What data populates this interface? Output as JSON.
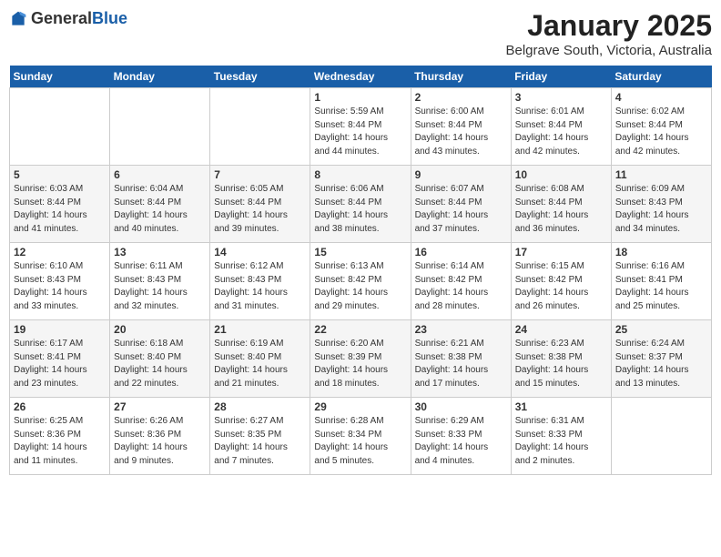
{
  "header": {
    "logo_general": "General",
    "logo_blue": "Blue",
    "month": "January 2025",
    "location": "Belgrave South, Victoria, Australia"
  },
  "days_of_week": [
    "Sunday",
    "Monday",
    "Tuesday",
    "Wednesday",
    "Thursday",
    "Friday",
    "Saturday"
  ],
  "weeks": [
    {
      "cells": [
        {
          "date": "",
          "info": ""
        },
        {
          "date": "",
          "info": ""
        },
        {
          "date": "",
          "info": ""
        },
        {
          "date": "1",
          "info": "Sunrise: 5:59 AM\nSunset: 8:44 PM\nDaylight: 14 hours\nand 44 minutes."
        },
        {
          "date": "2",
          "info": "Sunrise: 6:00 AM\nSunset: 8:44 PM\nDaylight: 14 hours\nand 43 minutes."
        },
        {
          "date": "3",
          "info": "Sunrise: 6:01 AM\nSunset: 8:44 PM\nDaylight: 14 hours\nand 42 minutes."
        },
        {
          "date": "4",
          "info": "Sunrise: 6:02 AM\nSunset: 8:44 PM\nDaylight: 14 hours\nand 42 minutes."
        }
      ]
    },
    {
      "cells": [
        {
          "date": "5",
          "info": "Sunrise: 6:03 AM\nSunset: 8:44 PM\nDaylight: 14 hours\nand 41 minutes."
        },
        {
          "date": "6",
          "info": "Sunrise: 6:04 AM\nSunset: 8:44 PM\nDaylight: 14 hours\nand 40 minutes."
        },
        {
          "date": "7",
          "info": "Sunrise: 6:05 AM\nSunset: 8:44 PM\nDaylight: 14 hours\nand 39 minutes."
        },
        {
          "date": "8",
          "info": "Sunrise: 6:06 AM\nSunset: 8:44 PM\nDaylight: 14 hours\nand 38 minutes."
        },
        {
          "date": "9",
          "info": "Sunrise: 6:07 AM\nSunset: 8:44 PM\nDaylight: 14 hours\nand 37 minutes."
        },
        {
          "date": "10",
          "info": "Sunrise: 6:08 AM\nSunset: 8:44 PM\nDaylight: 14 hours\nand 36 minutes."
        },
        {
          "date": "11",
          "info": "Sunrise: 6:09 AM\nSunset: 8:43 PM\nDaylight: 14 hours\nand 34 minutes."
        }
      ]
    },
    {
      "cells": [
        {
          "date": "12",
          "info": "Sunrise: 6:10 AM\nSunset: 8:43 PM\nDaylight: 14 hours\nand 33 minutes."
        },
        {
          "date": "13",
          "info": "Sunrise: 6:11 AM\nSunset: 8:43 PM\nDaylight: 14 hours\nand 32 minutes."
        },
        {
          "date": "14",
          "info": "Sunrise: 6:12 AM\nSunset: 8:43 PM\nDaylight: 14 hours\nand 31 minutes."
        },
        {
          "date": "15",
          "info": "Sunrise: 6:13 AM\nSunset: 8:42 PM\nDaylight: 14 hours\nand 29 minutes."
        },
        {
          "date": "16",
          "info": "Sunrise: 6:14 AM\nSunset: 8:42 PM\nDaylight: 14 hours\nand 28 minutes."
        },
        {
          "date": "17",
          "info": "Sunrise: 6:15 AM\nSunset: 8:42 PM\nDaylight: 14 hours\nand 26 minutes."
        },
        {
          "date": "18",
          "info": "Sunrise: 6:16 AM\nSunset: 8:41 PM\nDaylight: 14 hours\nand 25 minutes."
        }
      ]
    },
    {
      "cells": [
        {
          "date": "19",
          "info": "Sunrise: 6:17 AM\nSunset: 8:41 PM\nDaylight: 14 hours\nand 23 minutes."
        },
        {
          "date": "20",
          "info": "Sunrise: 6:18 AM\nSunset: 8:40 PM\nDaylight: 14 hours\nand 22 minutes."
        },
        {
          "date": "21",
          "info": "Sunrise: 6:19 AM\nSunset: 8:40 PM\nDaylight: 14 hours\nand 21 minutes."
        },
        {
          "date": "22",
          "info": "Sunrise: 6:20 AM\nSunset: 8:39 PM\nDaylight: 14 hours\nand 18 minutes."
        },
        {
          "date": "23",
          "info": "Sunrise: 6:21 AM\nSunset: 8:38 PM\nDaylight: 14 hours\nand 17 minutes."
        },
        {
          "date": "24",
          "info": "Sunrise: 6:23 AM\nSunset: 8:38 PM\nDaylight: 14 hours\nand 15 minutes."
        },
        {
          "date": "25",
          "info": "Sunrise: 6:24 AM\nSunset: 8:37 PM\nDaylight: 14 hours\nand 13 minutes."
        }
      ]
    },
    {
      "cells": [
        {
          "date": "26",
          "info": "Sunrise: 6:25 AM\nSunset: 8:36 PM\nDaylight: 14 hours\nand 11 minutes."
        },
        {
          "date": "27",
          "info": "Sunrise: 6:26 AM\nSunset: 8:36 PM\nDaylight: 14 hours\nand 9 minutes."
        },
        {
          "date": "28",
          "info": "Sunrise: 6:27 AM\nSunset: 8:35 PM\nDaylight: 14 hours\nand 7 minutes."
        },
        {
          "date": "29",
          "info": "Sunrise: 6:28 AM\nSunset: 8:34 PM\nDaylight: 14 hours\nand 5 minutes."
        },
        {
          "date": "30",
          "info": "Sunrise: 6:29 AM\nSunset: 8:33 PM\nDaylight: 14 hours\nand 4 minutes."
        },
        {
          "date": "31",
          "info": "Sunrise: 6:31 AM\nSunset: 8:33 PM\nDaylight: 14 hours\nand 2 minutes."
        },
        {
          "date": "",
          "info": ""
        }
      ]
    }
  ]
}
